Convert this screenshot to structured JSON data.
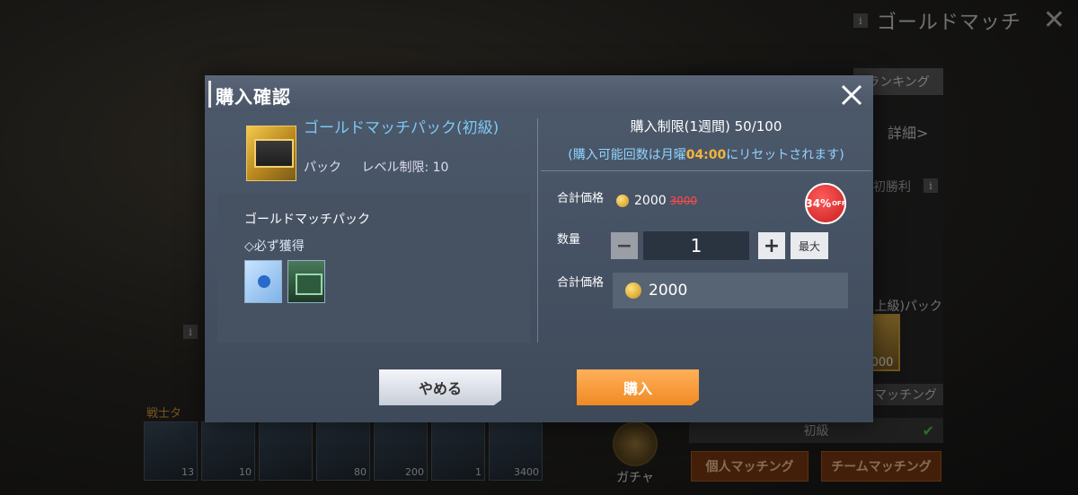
{
  "background": {
    "mode_title": "ゴールドマッチ",
    "info_icon_label": "i",
    "ranking_label": "ランキング",
    "detail_label": "詳細>",
    "first_win_label": "初勝利",
    "pack_label": "(上級)パック",
    "chest_count": "000",
    "matching_label": "マッチング",
    "grade_label": "初級",
    "personal_match_label": "個人マッチング",
    "team_match_label": "チームマッチング",
    "tab_label": "戦士タ",
    "gacha_label": "ガチャ",
    "slots": [
      "13",
      "10",
      "",
      "80",
      "200",
      "1",
      "3400"
    ]
  },
  "modal": {
    "title": "購入確認",
    "item": {
      "name": "ゴールドマッチパック(初級)",
      "type": "パック",
      "level_limit": "レベル制限: 10"
    },
    "contents": {
      "title": "ゴールドマッチパック",
      "guaranteed": "◇必ず獲得",
      "items": [
        "ticket-icon",
        "chest-icon"
      ]
    },
    "purchase_limit": "購入制限(1週間) 50/100",
    "reset_prefix": "(購入可能回数は月曜",
    "reset_time": "04:00",
    "reset_suffix": "にリセットされます)",
    "price_label": "合計価格",
    "price": "2000",
    "price_original": "3000",
    "discount": "34%",
    "discount_suffix": "OFF",
    "quantity_label": "数量",
    "quantity": "1",
    "minus_label": "−",
    "plus_label": "+",
    "max_label": "最大",
    "total_label": "合計価格",
    "total": "2000",
    "cancel_label": "やめる",
    "buy_label": "購入"
  },
  "colors": {
    "accent_orange": "#f08a24",
    "item_name_blue": "#7ec8f2",
    "reset_time": "#f5b43a",
    "discount_red": "#c81e1e"
  }
}
